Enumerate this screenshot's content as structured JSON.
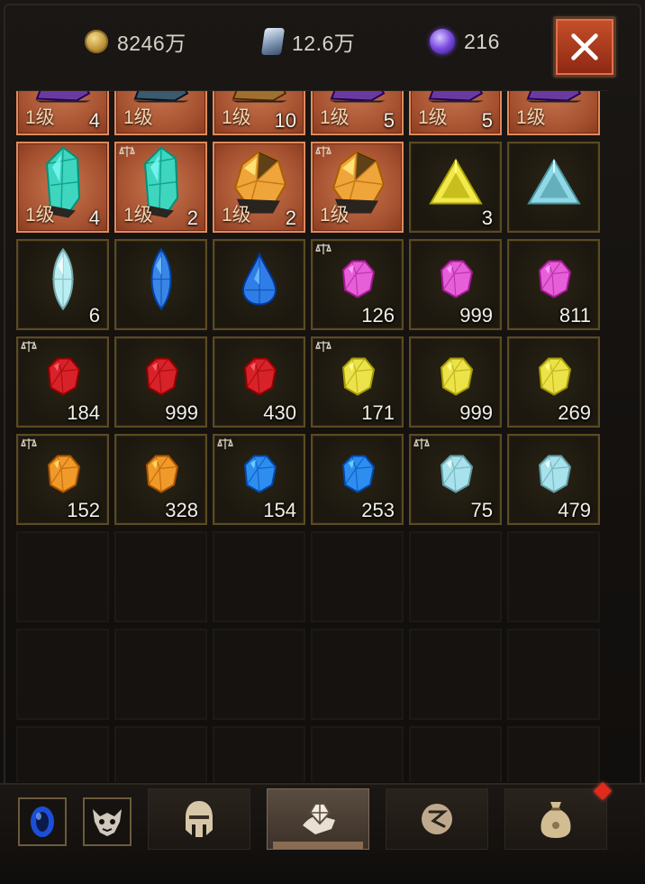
{
  "currencies": [
    {
      "icon": "gold-coin-icon",
      "value": "8246万"
    },
    {
      "icon": "scroll-shard-icon",
      "value": "12.6万"
    },
    {
      "icon": "purple-orb-icon",
      "value": "216"
    }
  ],
  "close_label": "✕",
  "rows": [
    [
      {
        "frame": "orange",
        "level": "1级",
        "count": "4",
        "item": "dark-crystal",
        "color": "#6b3aa0"
      },
      {
        "frame": "orange",
        "level": "1级",
        "count": "",
        "item": "dark-crystal",
        "color": "#3c5a6e"
      },
      {
        "frame": "orange",
        "level": "1级",
        "count": "10",
        "item": "dark-crystal",
        "color": "#a07030"
      },
      {
        "frame": "orange",
        "level": "1级",
        "count": "5",
        "item": "dark-crystal",
        "color": "#6b3aa0"
      },
      {
        "frame": "orange",
        "level": "1级",
        "count": "5",
        "item": "dark-crystal",
        "color": "#6b3aa0"
      },
      {
        "frame": "orange",
        "level": "1级",
        "count": "",
        "item": "dark-crystal",
        "color": "#6b3aa0"
      }
    ],
    [
      {
        "frame": "orange",
        "level": "1级",
        "count": "4",
        "scale": false,
        "item": "crystal",
        "color": "#3fd6c0"
      },
      {
        "frame": "orange",
        "level": "1级",
        "count": "2",
        "scale": true,
        "item": "crystal",
        "color": "#3fd6c0"
      },
      {
        "frame": "orange",
        "level": "1级",
        "count": "2",
        "scale": false,
        "item": "rough-gem",
        "color": "#f0a53a"
      },
      {
        "frame": "orange",
        "level": "1级",
        "count": "",
        "scale": true,
        "item": "rough-gem",
        "color": "#f0a53a"
      },
      {
        "frame": "gold",
        "level": "",
        "count": "3",
        "scale": false,
        "item": "triangle",
        "color": "#f2e94a"
      },
      {
        "frame": "gold",
        "level": "",
        "count": "",
        "scale": false,
        "item": "triangle",
        "color": "#8fd8e6"
      }
    ],
    [
      {
        "frame": "gold",
        "level": "",
        "count": "6",
        "scale": false,
        "item": "marquise",
        "color": "#b9eef2"
      },
      {
        "frame": "gold",
        "level": "",
        "count": "",
        "scale": false,
        "item": "marquise",
        "color": "#3a86e8"
      },
      {
        "frame": "gold",
        "level": "",
        "count": "",
        "scale": false,
        "item": "teardrop",
        "color": "#2f7de6"
      },
      {
        "frame": "gold",
        "level": "",
        "count": "126",
        "scale": true,
        "item": "gem",
        "color": "#e65fd8"
      },
      {
        "frame": "gold",
        "level": "",
        "count": "999",
        "scale": false,
        "item": "gem",
        "color": "#e65fd8"
      },
      {
        "frame": "gold",
        "level": "",
        "count": "811",
        "scale": false,
        "item": "gem",
        "color": "#e65fd8"
      }
    ],
    [
      {
        "frame": "gold",
        "level": "",
        "count": "184",
        "scale": true,
        "item": "gem",
        "color": "#d8222a"
      },
      {
        "frame": "gold",
        "level": "",
        "count": "999",
        "scale": false,
        "item": "gem",
        "color": "#d8222a"
      },
      {
        "frame": "gold",
        "level": "",
        "count": "430",
        "scale": false,
        "item": "gem",
        "color": "#d8222a"
      },
      {
        "frame": "gold",
        "level": "",
        "count": "171",
        "scale": true,
        "item": "gem",
        "color": "#ece24a"
      },
      {
        "frame": "gold",
        "level": "",
        "count": "999",
        "scale": false,
        "item": "gem",
        "color": "#ece24a"
      },
      {
        "frame": "gold",
        "level": "",
        "count": "269",
        "scale": false,
        "item": "gem",
        "color": "#ece24a"
      }
    ],
    [
      {
        "frame": "gold",
        "level": "",
        "count": "152",
        "scale": true,
        "item": "gem",
        "color": "#f09a2a"
      },
      {
        "frame": "gold",
        "level": "",
        "count": "328",
        "scale": false,
        "item": "gem",
        "color": "#f09a2a"
      },
      {
        "frame": "gold",
        "level": "",
        "count": "154",
        "scale": true,
        "item": "gem",
        "color": "#2e8ef0"
      },
      {
        "frame": "gold",
        "level": "",
        "count": "253",
        "scale": false,
        "item": "gem",
        "color": "#2e8ef0"
      },
      {
        "frame": "gold",
        "level": "",
        "count": "75",
        "scale": true,
        "item": "gem",
        "color": "#a8e2ec"
      },
      {
        "frame": "gold",
        "level": "",
        "count": "479",
        "scale": false,
        "item": "gem",
        "color": "#a8e2ec"
      }
    ],
    [
      {
        "frame": "empty"
      },
      {
        "frame": "empty"
      },
      {
        "frame": "empty"
      },
      {
        "frame": "empty"
      },
      {
        "frame": "empty"
      },
      {
        "frame": "empty"
      }
    ],
    [
      {
        "frame": "empty"
      },
      {
        "frame": "empty"
      },
      {
        "frame": "empty"
      },
      {
        "frame": "empty"
      },
      {
        "frame": "empty"
      },
      {
        "frame": "empty"
      }
    ],
    [
      {
        "frame": "empty"
      },
      {
        "frame": "empty"
      },
      {
        "frame": "empty"
      },
      {
        "frame": "empty"
      },
      {
        "frame": "empty"
      },
      {
        "frame": "empty"
      }
    ]
  ],
  "tabs": [
    {
      "name": "sapphire-tab",
      "icon": "blue-ring-icon"
    },
    {
      "name": "demon-tab",
      "icon": "demon-mask-icon"
    },
    {
      "name": "equipment-tab",
      "icon": "helmet-icon"
    },
    {
      "name": "gems-tab",
      "icon": "gem-hand-icon",
      "active": true
    },
    {
      "name": "quest-tab",
      "icon": "rune-icon"
    },
    {
      "name": "bag-tab",
      "icon": "sack-icon",
      "notification": true
    }
  ]
}
